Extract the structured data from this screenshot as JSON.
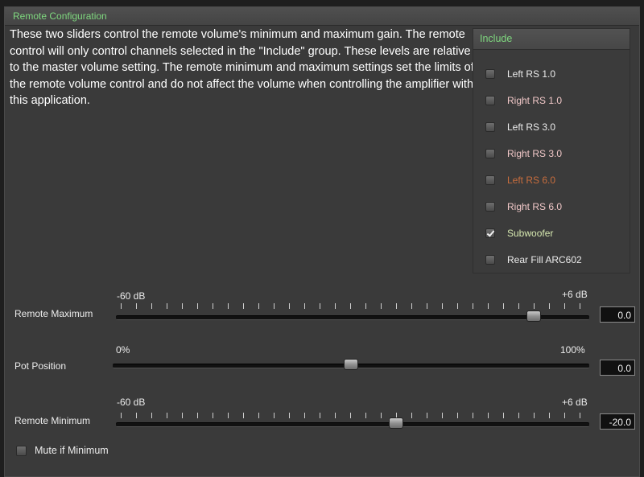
{
  "panel": {
    "title": "Remote Configuration",
    "description": "These two sliders control the remote volume's minimum and maximum gain. The remote control will only control channels selected in the \"Include\" group.  These levels are relative to the master volume setting.  The remote minimum and maximum settings set the limits of the remote volume control and do not affect the volume when controlling the amplifier with this application."
  },
  "include": {
    "title": "Include",
    "items": [
      {
        "label": "Left RS 1.0",
        "checked": false,
        "color": "#ececec"
      },
      {
        "label": "Right RS 1.0",
        "checked": false,
        "color": "#f1c8c8"
      },
      {
        "label": "Left RS 3.0",
        "checked": false,
        "color": "#ececec"
      },
      {
        "label": "Right RS 3.0",
        "checked": false,
        "color": "#f1c8c8"
      },
      {
        "label": "Left RS 6.0",
        "checked": false,
        "color": "#c86d3d"
      },
      {
        "label": "Right RS 6.0",
        "checked": false,
        "color": "#f1c8c8"
      },
      {
        "label": "Subwoofer",
        "checked": true,
        "color": "#d6e8b0"
      },
      {
        "label": "Rear Fill ARC602",
        "checked": false,
        "color": "#ececec"
      }
    ]
  },
  "sliders": {
    "remote_maximum": {
      "label": "Remote Maximum",
      "min_label": "-60 dB",
      "max_label": "+6 dB",
      "value": "0.0",
      "fraction": 0.9
    },
    "pot_position": {
      "label": "Pot Position",
      "min_label": "0%",
      "max_label": "100%",
      "value": "0.0",
      "fraction": 0.5
    },
    "remote_minimum": {
      "label": "Remote Minimum",
      "min_label": "-60 dB",
      "max_label": "+6 dB",
      "value": "-20.0",
      "fraction": 0.6
    }
  },
  "mute": {
    "label": "Mute if Minimum",
    "checked": false
  },
  "colors": {
    "accent_green": "#7fd87f",
    "panel_bg": "#3a3a3a"
  }
}
